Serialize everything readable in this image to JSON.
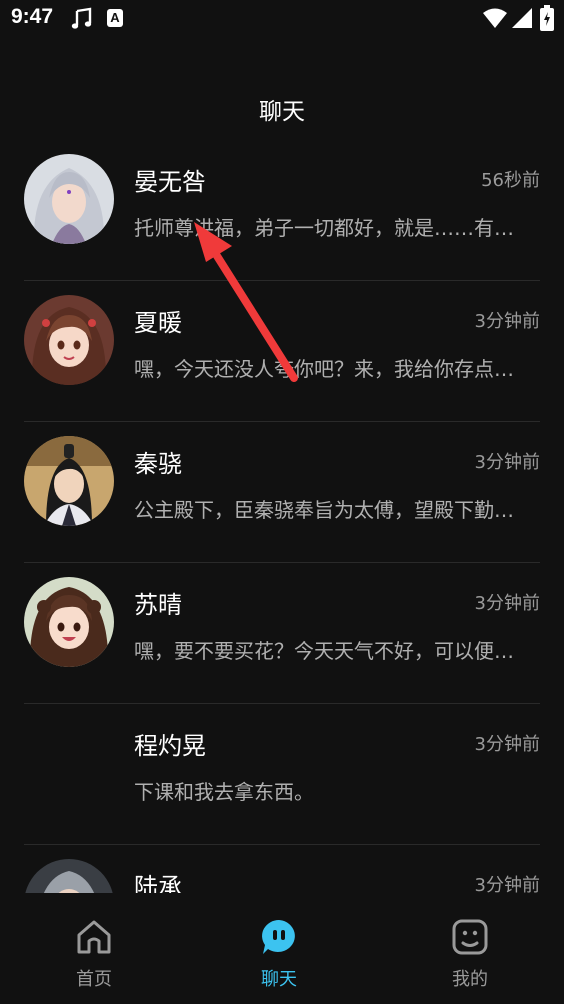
{
  "status_bar": {
    "time": "9:47",
    "a_badge": "A",
    "icons": [
      "music-note-icon",
      "notification-a-icon",
      "wifi-icon",
      "signal-icon",
      "battery-icon"
    ]
  },
  "header": {
    "title": "聊天"
  },
  "chats": [
    {
      "name": "晏无咎",
      "time": "56秒前",
      "message": "托师尊洪福，弟子一切都好，就是……有事想要和师尊说",
      "avatar": "silver-haired-man-avatar"
    },
    {
      "name": "夏暖",
      "time": "3分钟前",
      "message": "嘿，今天还没人夸你吧？来，我给你存点好话",
      "avatar": "brown-haired-girl-avatar"
    },
    {
      "name": "秦骁",
      "time": "3分钟前",
      "message": "公主殿下，臣秦骁奉旨为太傅，望殿下勤勉好学",
      "avatar": "ancient-man-avatar"
    },
    {
      "name": "苏晴",
      "time": "3分钟前",
      "message": "嘿，要不要买花？今天天气不好，可以便宜卖给你",
      "avatar": "curly-haired-girl-avatar"
    },
    {
      "name": "程灼晃",
      "time": "3分钟前",
      "message": "下课和我去拿东西。",
      "avatar": ""
    },
    {
      "name": "陆承",
      "time": "3分钟前",
      "message": "",
      "avatar": "grey-haired-man-avatar"
    }
  ],
  "tabbar": {
    "home": "首页",
    "chat": "聊天",
    "mine": "我的",
    "active": "聊天"
  },
  "colors": {
    "background": "#111111",
    "accent": "#3cc3f0",
    "arrow": "#f03a3a"
  }
}
